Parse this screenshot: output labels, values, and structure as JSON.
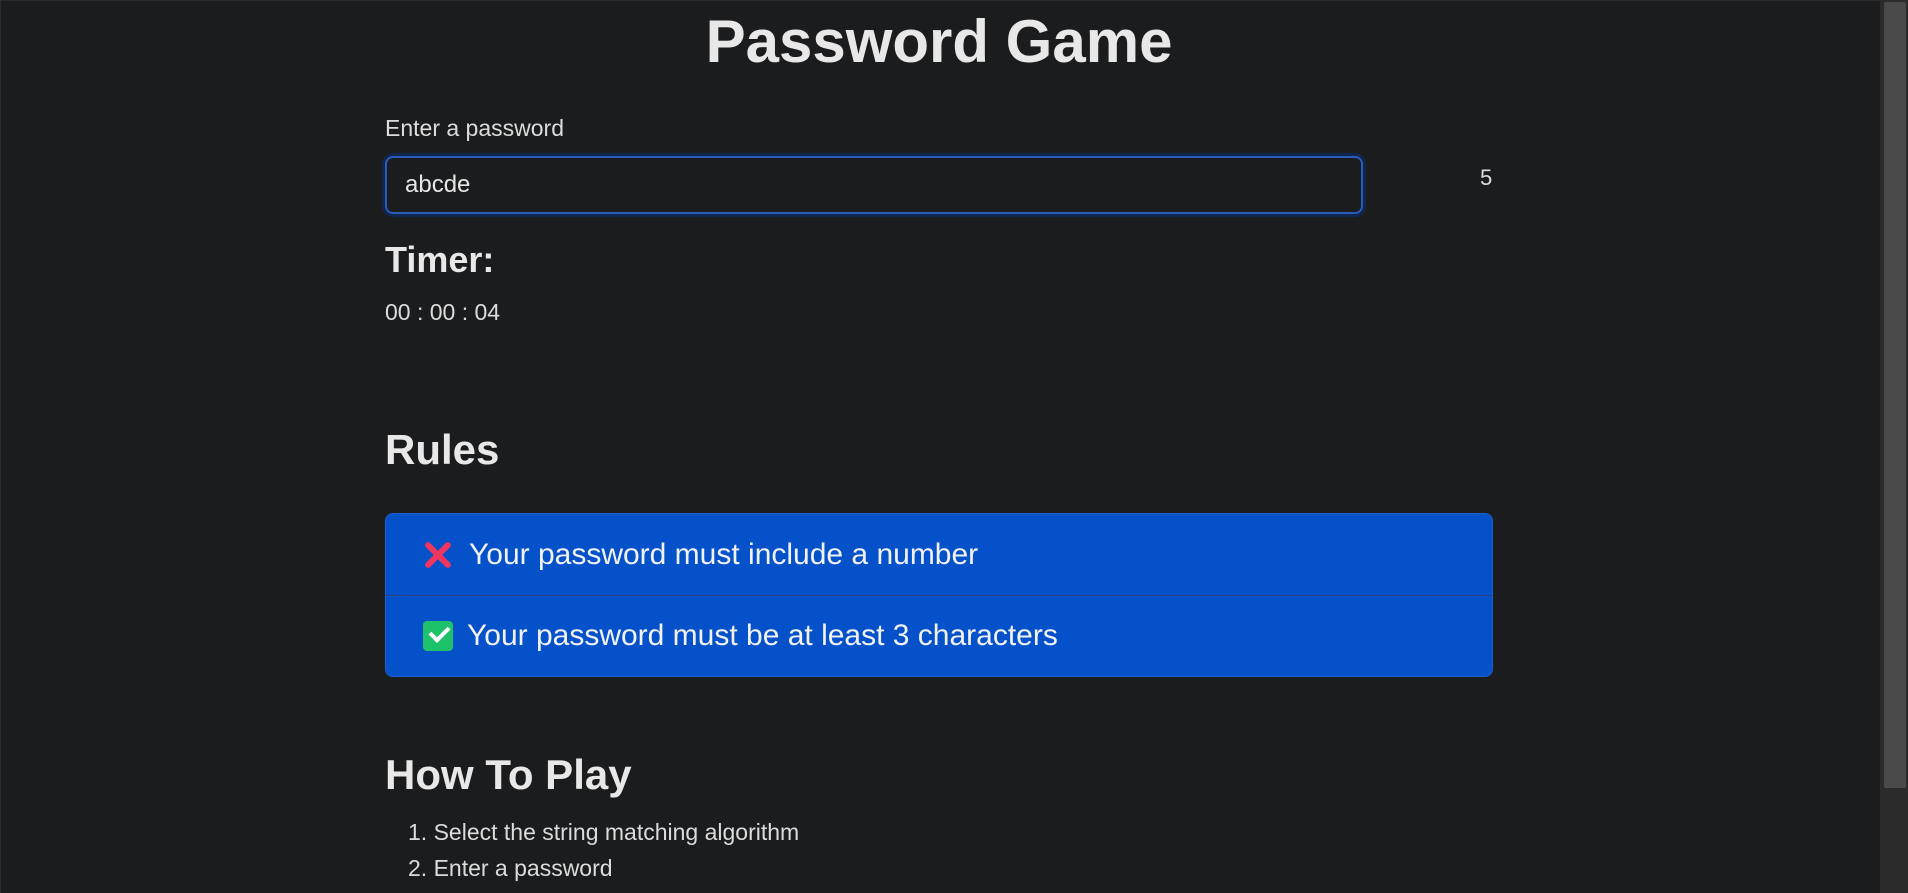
{
  "page": {
    "title": "Password Game"
  },
  "password": {
    "label": "Enter a password",
    "value": "abcde",
    "length": "5"
  },
  "timer": {
    "heading": "Timer:",
    "value": "00 : 00 : 04"
  },
  "rules": {
    "heading": "Rules",
    "items": [
      {
        "text": "Your password must include a number",
        "status": "failed",
        "icon": "cross-icon"
      },
      {
        "text": "Your password must be at least 3 characters",
        "status": "passed",
        "icon": "check-icon"
      }
    ]
  },
  "how_to_play": {
    "heading": "How To Play",
    "steps": [
      "1. Select the string matching algorithm",
      "2. Enter a password"
    ]
  },
  "colors": {
    "background": "#1b1c1e",
    "rule_panel": "#0451c9",
    "fail": "#f0355f",
    "pass": "#1ec26a",
    "input_focus": "#2b5bb8"
  }
}
